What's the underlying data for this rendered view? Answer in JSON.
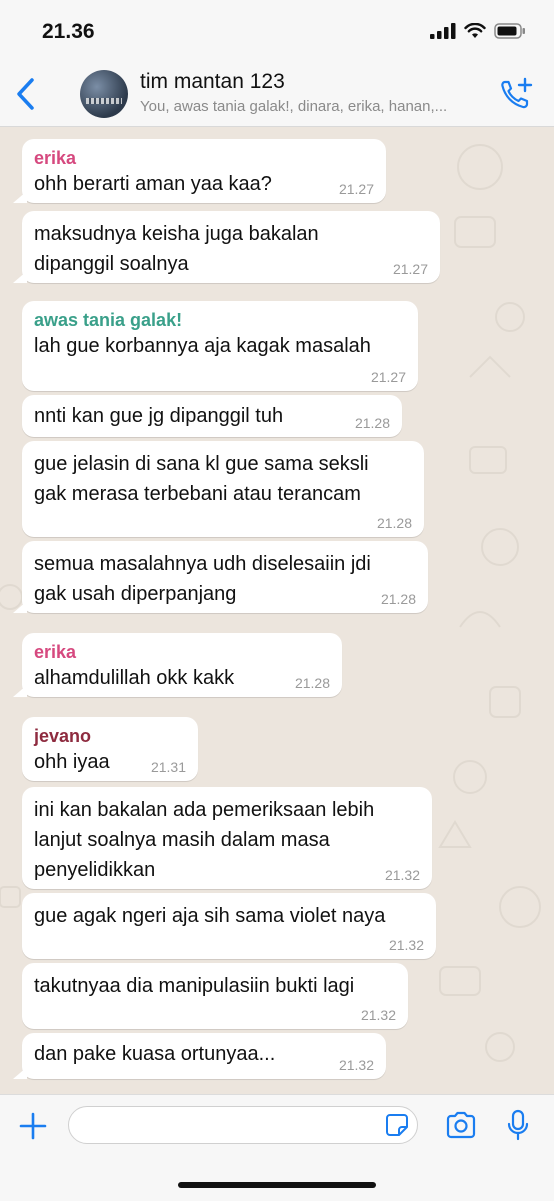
{
  "status": {
    "time": "21.36"
  },
  "header": {
    "title": "tim mantan 123",
    "subtitle": "You, awas tania galak!, dinara, erika, hanan,..."
  },
  "colors": {
    "erika": "#d6497f",
    "awas": "#3aa08a",
    "jevano": "#8e2b3f",
    "accent": "#1a7df0"
  },
  "messages": [
    {
      "sender": "erika",
      "lines": [
        "ohh berarti aman yaa kaa?"
      ],
      "time": "21.27"
    },
    {
      "sender": "",
      "lines": [
        "maksudnya keisha juga bakalan",
        "dipanggil soalnya"
      ],
      "time": "21.27"
    },
    {
      "sender": "awas tania galak!",
      "lines": [
        "lah gue korbannya aja kagak masalah"
      ],
      "time": "21.27"
    },
    {
      "sender": "",
      "lines": [
        "nnti kan gue jg dipanggil tuh"
      ],
      "time": "21.28"
    },
    {
      "sender": "",
      "lines": [
        "gue jelasin di sana kl gue sama seksli",
        "gak merasa terbebani atau terancam"
      ],
      "time": "21.28"
    },
    {
      "sender": "",
      "lines": [
        "semua masalahnya udh diselesaiin jdi",
        "gak usah diperpanjang"
      ],
      "time": "21.28"
    },
    {
      "sender": "erika",
      "lines": [
        "alhamdulillah okk kakk"
      ],
      "time": "21.28"
    },
    {
      "sender": "jevano",
      "lines": [
        "ohh iyaa"
      ],
      "time": "21.31"
    },
    {
      "sender": "",
      "lines": [
        "ini kan bakalan ada pemeriksaan lebih",
        "lanjut soalnya masih dalam masa",
        "penyelidikkan"
      ],
      "time": "21.32"
    },
    {
      "sender": "",
      "lines": [
        "gue agak ngeri aja sih sama violet naya"
      ],
      "time": "21.32"
    },
    {
      "sender": "",
      "lines": [
        "takutnyaa dia manipulasiin bukti lagi"
      ],
      "time": "21.32"
    },
    {
      "sender": "",
      "lines": [
        "dan pake kuasa ortunyaa..."
      ],
      "time": "21.32"
    }
  ]
}
